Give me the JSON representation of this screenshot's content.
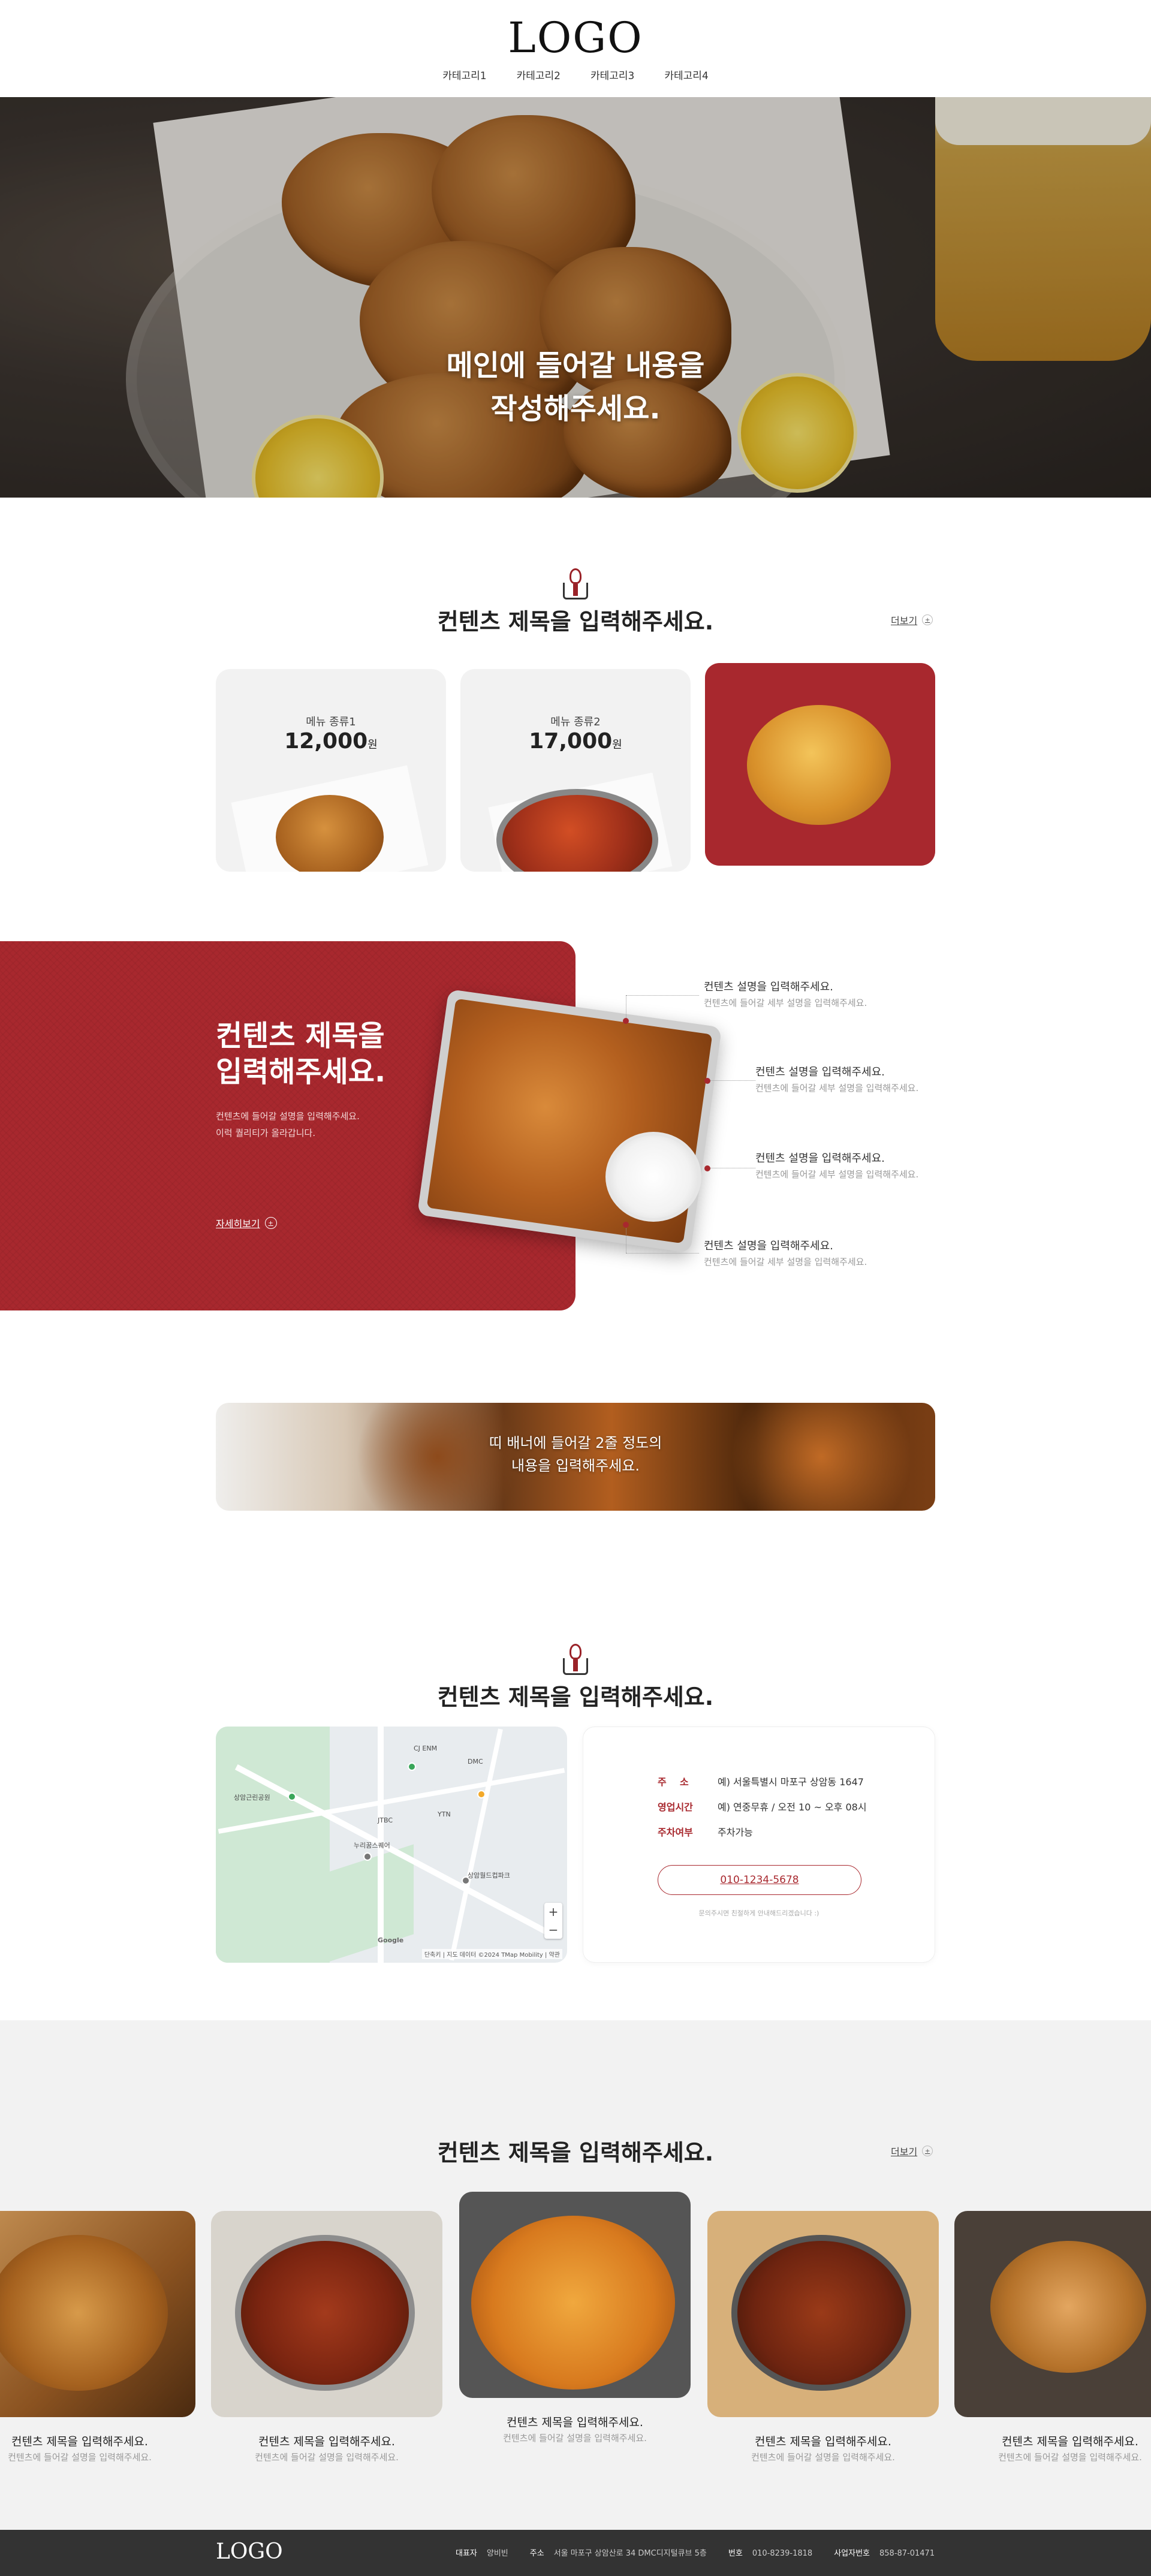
{
  "header": {
    "logo": "LOGO",
    "nav": [
      "카테고리1",
      "카테고리2",
      "카테고리3",
      "카테고리4"
    ]
  },
  "hero": {
    "line1": "메인에 들어갈 내용을",
    "line2": "작성해주세요."
  },
  "menu_section": {
    "title": "컨텐츠 제목을 입력해주세요.",
    "more": "더보기",
    "cards": [
      {
        "category": "메뉴 종류1",
        "price": "12,000",
        "unit": "원"
      },
      {
        "category": "메뉴 종류2",
        "price": "17,000",
        "unit": "원"
      }
    ]
  },
  "feature": {
    "title_l1": "컨텐츠 제목을",
    "title_l2": "입력해주세요.",
    "desc_l1": "컨텐츠에 들어갈 설명을 입력해주세요.",
    "desc_l2": "이럭 퀄리티가 올라갑니다.",
    "link": "자세히보기",
    "items": [
      {
        "title": "컨텐츠 설명을 입력해주세요.",
        "desc": "컨텐츠에 들어갈 세부 설명을 입력해주세요."
      },
      {
        "title": "컨텐츠 설명을 입력해주세요.",
        "desc": "컨텐츠에 들어갈 세부 설명을 입력해주세요."
      },
      {
        "title": "컨텐츠 설명을 입력해주세요.",
        "desc": "컨텐츠에 들어갈 세부 설명을 입력해주세요."
      },
      {
        "title": "컨텐츠 설명을 입력해주세요.",
        "desc": "컨텐츠에 들어갈 세부 설명을 입력해주세요."
      }
    ]
  },
  "banner": {
    "line1": "띠 배너에 들어갈 2줄 정도의",
    "line2": "내용을 입력해주세요."
  },
  "location": {
    "title": "컨텐츠 제목을 입력해주세요.",
    "address_key": "주    소",
    "address": "예) 서울특별시 마포구 상암동 1647",
    "hours_key": "영업시간",
    "hours": "예) 연중무휴 / 오전 10 ~ 오후 08시",
    "parking_key": "주차여부",
    "parking": "주차가능",
    "tel": "010-1234-5678",
    "note": "문의주시면 친절하게 안내해드리겠습니다 :)",
    "map_labels": [
      "CJ ENM",
      "DMC",
      "상암근린공원",
      "JTBC",
      "YTN",
      "누리꿈스퀘어",
      "상암월드컵파크",
      "Google",
      "단축키",
      "지도 데이터 ©2024 TMap Mobility",
      "약관"
    ]
  },
  "carousel": {
    "title": "컨텐츠 제목을 입력해주세요.",
    "more": "더보기",
    "items": [
      {
        "title": "컨텐츠 제목을 입력해주세요.",
        "desc": "컨텐츠에 들어갈 설명을 입력해주세요."
      },
      {
        "title": "컨텐츠 제목을 입력해주세요.",
        "desc": "컨텐츠에 들어갈 설명을 입력해주세요."
      },
      {
        "title": "컨텐츠 제목을 입력해주세요.",
        "desc": "컨텐츠에 들어갈 설명을 입력해주세요."
      },
      {
        "title": "컨텐츠 제목을 입력해주세요.",
        "desc": "컨텐츠에 들어갈 설명을 입력해주세요."
      },
      {
        "title": "컨텐츠 제목을 입력해주세요.",
        "desc": "컨텐츠에 들어갈 설명을 입력해주세요."
      }
    ]
  },
  "footer": {
    "logo": "LOGO",
    "ceo_key": "대표자",
    "ceo": "양비빈",
    "addr_key": "주소",
    "addr": "서울 마포구 상암산로 34 DMC디지털큐브 5층",
    "phone_key": "번호",
    "phone": "010-8239-1818",
    "biz_key": "사업자번호",
    "biz": "858-87-01471"
  },
  "colors": {
    "accent": "#a8282e",
    "footer_bg": "#333333",
    "gray_bg": "#f2f2f2"
  },
  "icons": [
    "mascot-icon",
    "plus-circle-icon",
    "map-pin-icon"
  ]
}
